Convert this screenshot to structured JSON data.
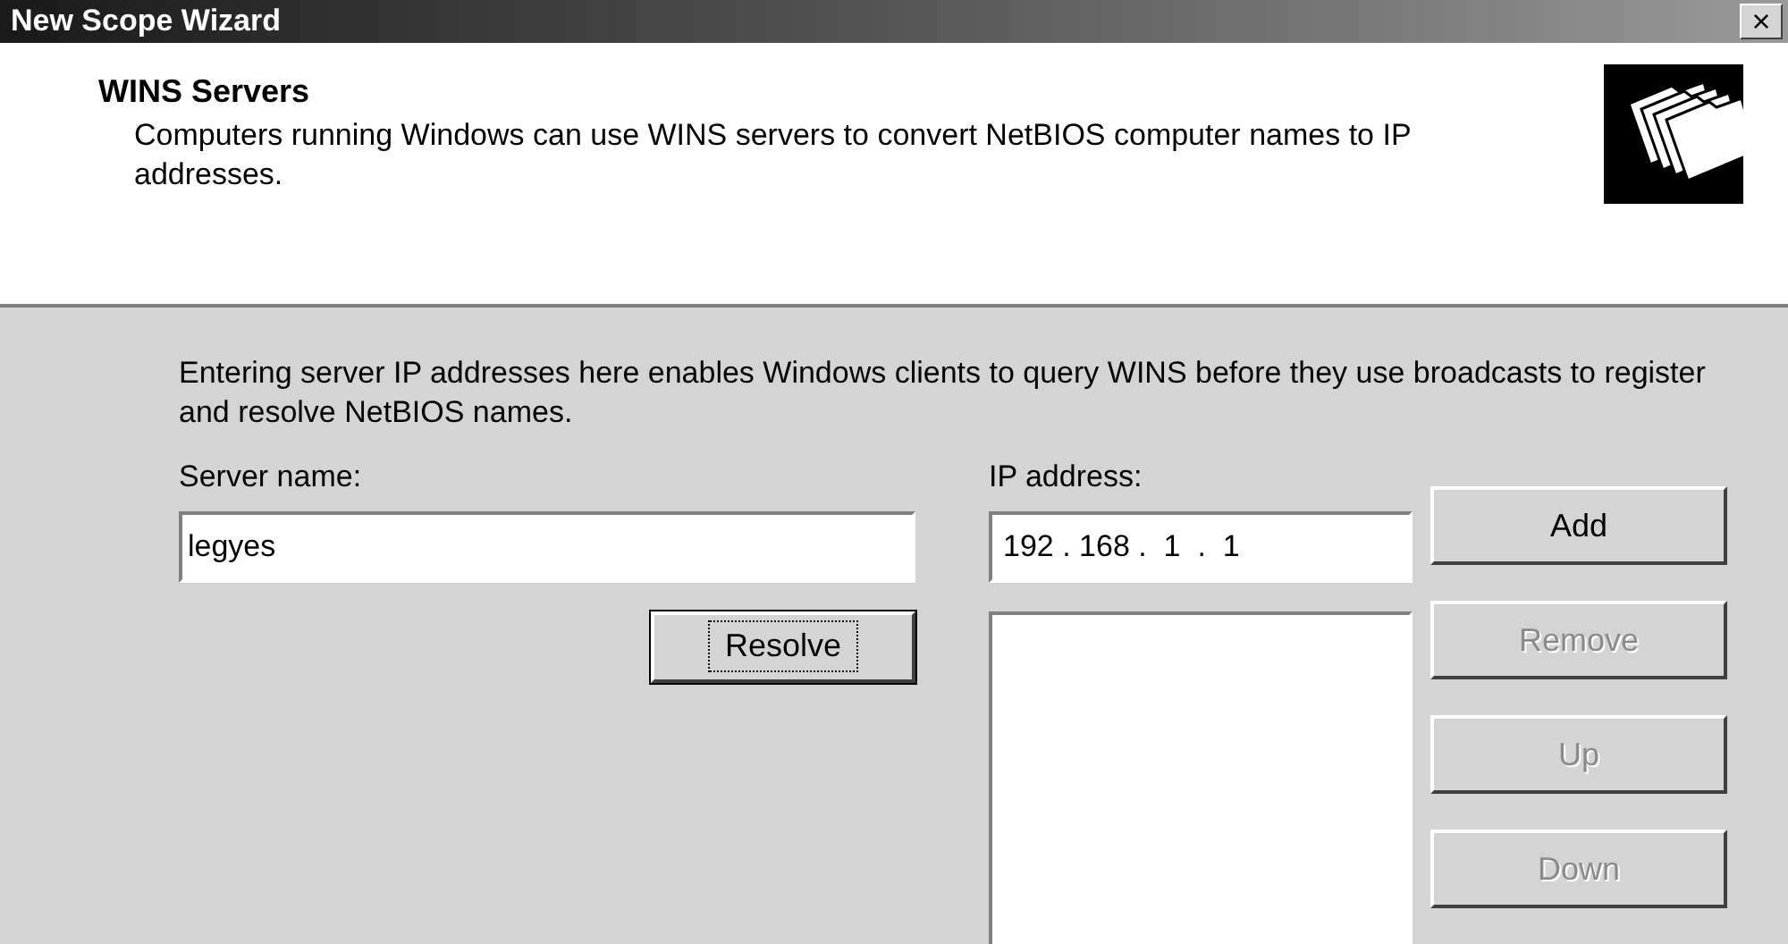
{
  "window": {
    "title": "New Scope Wizard",
    "close": "×"
  },
  "header": {
    "title": "WINS Servers",
    "description": "Computers running Windows can use WINS servers to convert NetBIOS computer names to IP addresses."
  },
  "intro": "Entering server IP addresses here enables Windows clients to query WINS before they use broadcasts to register and resolve NetBIOS names.",
  "server_name": {
    "label": "Server name:",
    "value": "legyes"
  },
  "ip_address": {
    "label": "IP address:",
    "value": "192 . 168 .  1  .  1"
  },
  "buttons": [
    {
      "label": "Add",
      "disabled": false,
      "focused": false
    },
    {
      "label": "Remove",
      "disabled": true,
      "focused": false
    },
    {
      "label": "Up",
      "disabled": true,
      "focused": false
    },
    {
      "label": "Down",
      "disabled": true,
      "focused": false
    }
  ],
  "resolve_button": {
    "label": "Resolve",
    "disabled": false,
    "focused": true
  }
}
